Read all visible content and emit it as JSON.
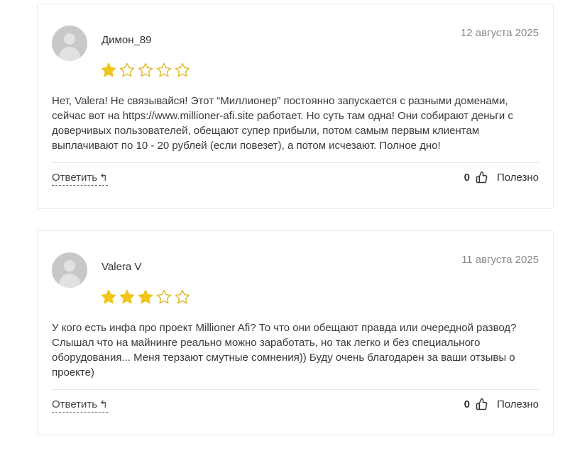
{
  "reviews": [
    {
      "author": "Димон_89",
      "date": "12 августа 2025",
      "rating": 1,
      "max_rating": 5,
      "text": "Нет, Valera! Не связывайся! Этот “Миллионер” постоянно запускается с разными доменами, сейчас вот на https://www.millioner-afi.site работает. Но суть там одна! Они собирают деньги с доверчивых пользователей, обещают супер прибыли, потом самым первым клиентам выплачивают по 10 - 20 рублей (если повезет), а потом исчезают. Полное дно!",
      "reply_label": "Ответить",
      "votes": "0",
      "useful_label": "Полезно"
    },
    {
      "author": "Valera V",
      "date": "11 августа 2025",
      "rating": 3,
      "max_rating": 5,
      "text": "У кого есть инфа про проект Millioner Afi? То что они обещают правда или очередной развод? Слышал что на майнинге реально можно заработать, но так легко и без специального оборудования... Меня терзают смутные сомнения)) Буду очень благодарен за ваши отзывы о проекте)",
      "reply_label": "Ответить",
      "votes": "0",
      "useful_label": "Полезно"
    }
  ],
  "colors": {
    "star_filled": "#f0c419",
    "star_empty_stroke": "#e0b825",
    "border": "#e8e8e8",
    "avatar": "#c8c8c8"
  },
  "icons": {
    "reply": "reply-arrow-icon",
    "thumb": "thumbs-up-icon",
    "star": "star-icon"
  }
}
